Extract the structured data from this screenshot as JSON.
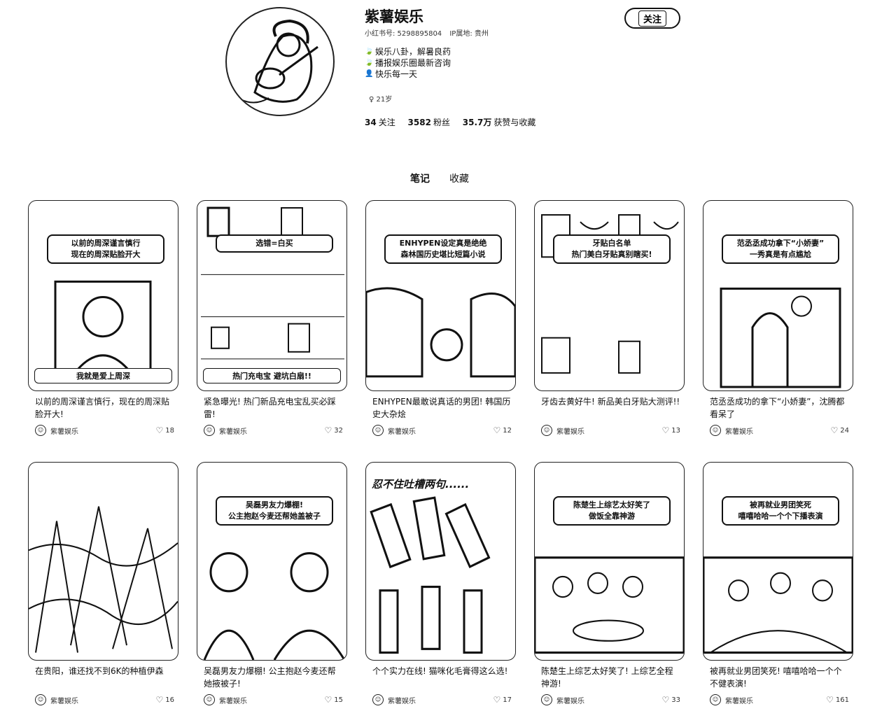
{
  "profile": {
    "name": "紫薯娱乐",
    "id_label": "小红书号: 5298895804",
    "ip_label": "IP属地: 贵州",
    "bio": [
      {
        "icon": "leaf-icon",
        "glyph": "🍃",
        "text": "娱乐八卦，解暑良药"
      },
      {
        "icon": "leaf-icon",
        "glyph": "🍃",
        "text": "播报娱乐圈最新咨询"
      },
      {
        "icon": "person-icon",
        "glyph": "👤",
        "text": "快乐每一天"
      }
    ],
    "age": "♀ 21岁",
    "stats": [
      {
        "value": "34",
        "label": "关注"
      },
      {
        "value": "3582",
        "label": "粉丝"
      },
      {
        "value": "35.7万",
        "label": "获赞与收藏"
      }
    ],
    "follow_label": "关注"
  },
  "tabs": [
    {
      "label": "笔记",
      "active": true
    },
    {
      "label": "收藏",
      "active": false
    }
  ],
  "notes": [
    {
      "cover_badge": [
        "以前的周深谨言慎行",
        "现在的周深贴脸开大"
      ],
      "cover_caption": "我就是爱上周深",
      "title": "以前的周深谨言慎行，现在的周深贴脸开大!",
      "author": "紫薯娱乐",
      "likes": "18"
    },
    {
      "cover_badge": [
        "选错=白买"
      ],
      "cover_caption": "热门充电宝 避坑白扇!!",
      "title": "紧急曝光! 热门新品充电宝乱买必踩雷!",
      "author": "紫薯娱乐",
      "likes": "32"
    },
    {
      "cover_badge": [
        "ENHYPEN设定真是绝绝",
        "森林国历史堪比短篇小说"
      ],
      "cover_caption": "",
      "title": "ENHYPEN最敢说真话的男团! 韩国历史大杂烩",
      "author": "紫薯娱乐",
      "likes": "12"
    },
    {
      "cover_badge": [
        "牙贴白名单",
        "热门美白牙贴真别瞎买!"
      ],
      "cover_caption": "",
      "title": "牙齿去黄好牛! 新品美白牙贴大测评!!",
      "author": "紫薯娱乐",
      "likes": "13"
    },
    {
      "cover_badge": [
        "范丞丞成功拿下“小娇妻”",
        "一秀真是有点尴尬"
      ],
      "cover_caption": "",
      "title": "范丞丞成功的拿下“小娇妻”，沈腾都看呆了",
      "author": "紫薯娱乐",
      "likes": "24"
    },
    {
      "cover_badge": [],
      "cover_caption": "",
      "title": "在贵阳，谁还找不到6K的种植伊森",
      "author": "紫薯娱乐",
      "likes": "16"
    },
    {
      "cover_badge": [
        "吴磊男友力爆棚!",
        "公主抱赵今麦还帮她盖被子"
      ],
      "cover_caption": "",
      "title": "吴磊男友力爆棚! 公主抱赵今麦还帮她掖被子!",
      "author": "紫薯娱乐",
      "likes": "15"
    },
    {
      "cover_badge": [],
      "cover_caption": "忍不住吐槽两句......",
      "title": "个个实力在线! 猫咪化毛膏得这么选!",
      "author": "紫薯娱乐",
      "likes": "17"
    },
    {
      "cover_badge": [
        "陈楚生上综艺太好笑了",
        "做饭全靠神游"
      ],
      "cover_caption": "",
      "title": "陈楚生上综艺太好笑了! 上综艺全程神游!",
      "author": "紫薯娱乐",
      "likes": "33"
    },
    {
      "cover_badge": [
        "被再就业男团笑死",
        "嘻嘻哈哈一个个下播表演"
      ],
      "cover_caption": "",
      "title": "被再就业男团笑死! 嘻嘻哈哈一个个不健表演!",
      "author": "紫薯娱乐",
      "likes": "161"
    }
  ]
}
